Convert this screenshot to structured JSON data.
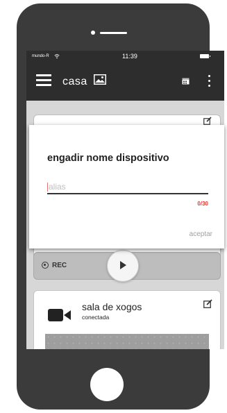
{
  "statusbar": {
    "carrier": "mundo-R",
    "time": "11:39"
  },
  "appbar": {
    "title": "casa"
  },
  "camera_controls": {
    "rec_label": "REC"
  },
  "device": {
    "name": "sala de xogos",
    "status": "conectada"
  },
  "dialog": {
    "title": "engadir nome dispositivo",
    "input_placeholder": "alias",
    "input_value": "",
    "counter": "0/30",
    "accept_label": "aceptar"
  },
  "colors": {
    "appbar": "#2d2d2d",
    "counter": "#e53935",
    "phone_body": "#3b3b3b"
  }
}
